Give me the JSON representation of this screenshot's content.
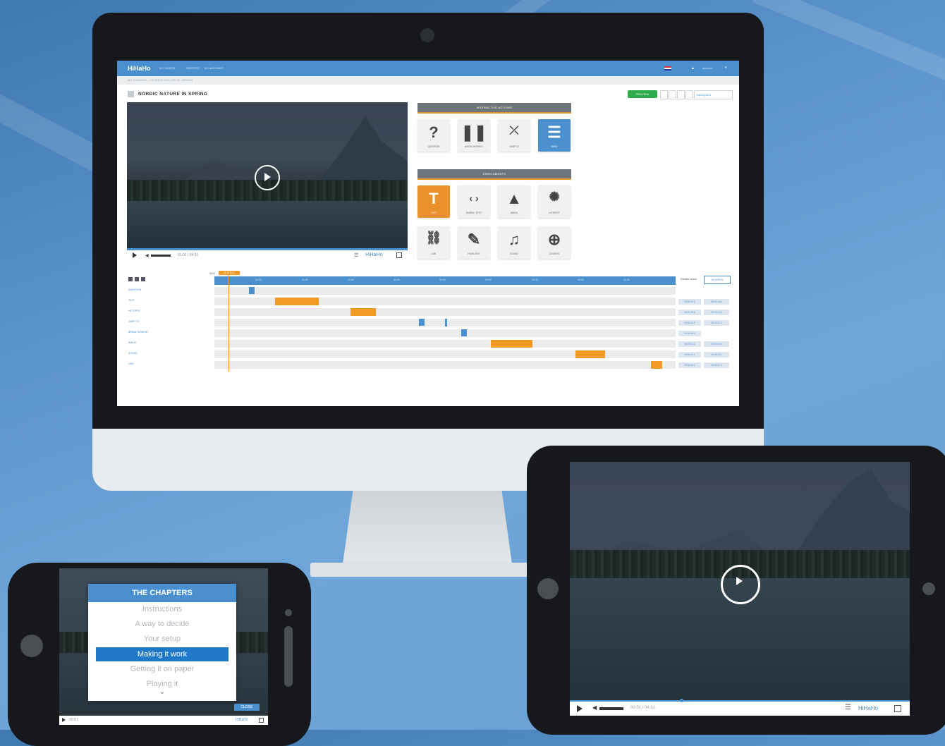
{
  "desktop": {
    "app": {
      "logo": "HiHaHo",
      "nav_items": [
        "MY VIDEOS",
        "SUPPORT",
        "MY ACCOUNT"
      ],
      "language_flag": "nl-flag-icon",
      "user_label": "account"
    },
    "breadcrumb": "MY CHANNEL > NORDIC NATURE IN SPRING",
    "video_title": "NORDIC NATURE IN SPRING",
    "toolbar": {
      "preview_label": "PREVIEW",
      "select_value": "Description"
    },
    "player": {
      "time": "01:01 / 04:31",
      "brand": "HiHaHo"
    },
    "interactive_actions": {
      "header": "INTERACTIVE ACTIONS",
      "tiles": [
        {
          "icon": "question-icon",
          "glyph": "?",
          "label": "QUESTION"
        },
        {
          "icon": "pause-icon",
          "glyph": "❚❚",
          "label": "BREAK MOMENT"
        },
        {
          "icon": "jump-to-icon",
          "glyph": "⤫",
          "label": "JUMP TO"
        },
        {
          "icon": "menu-icon",
          "glyph": "☰",
          "label": "MENU"
        }
      ]
    },
    "enrichments": {
      "header": "ENRICHMENTS",
      "tiles": [
        {
          "icon": "text-icon",
          "glyph": "T",
          "label": "TEXT"
        },
        {
          "icon": "code-icon",
          "glyph": "‹ ›",
          "label": "EMBED / TEXT"
        },
        {
          "icon": "image-icon",
          "glyph": "▲",
          "label": "IMAGE"
        },
        {
          "icon": "hotspot-icon",
          "glyph": "✺",
          "label": "HOTSPOT"
        },
        {
          "icon": "link-icon",
          "glyph": "⛓",
          "label": "LINK"
        },
        {
          "icon": "highlight-icon",
          "glyph": "✎",
          "label": "HIGHLIGHT"
        },
        {
          "icon": "music-icon",
          "glyph": "♫",
          "label": "SOUND"
        },
        {
          "icon": "zoom-icon",
          "glyph": "⊕",
          "label": "ZOOM IN"
        }
      ]
    },
    "timeline": {
      "ticks": [
        "00:00",
        "00:30",
        "01:00",
        "01:30",
        "02:00",
        "02:30",
        "03:00",
        "03:30",
        "04:00",
        "04:30"
      ],
      "cursor_time": "00:01:01.0",
      "details_label": "Details video",
      "details_button": "WIJZIGEN",
      "rows": [
        {
          "label": "QUESTION",
          "start": "",
          "end": ""
        },
        {
          "label": "TEXT",
          "start": "00:00:32.9",
          "end": "00:01:14.0"
        },
        {
          "label": "HOTSPOT",
          "start": "00:01:49.9",
          "end": "00:02:12.6"
        },
        {
          "label": "JUMP TO",
          "start": "00:02:44.9",
          "end": "00:02:47.6"
        },
        {
          "label": "BREAK MOMENT",
          "start": "00:03:06.9",
          "end": ""
        },
        {
          "label": "IMAGE",
          "start": "00:03:04.2",
          "end": "00:03:40.5"
        },
        {
          "label": "SOUND",
          "start": "00:04:03.1",
          "end": "00:04:28.1"
        },
        {
          "label": "LINK",
          "start": "00:04:40.0",
          "end": "00:04:47.0"
        }
      ]
    }
  },
  "tablet": {
    "time": "00:01 / 04:31",
    "brand": "HiHaHo"
  },
  "phone": {
    "chapters_title": "THE CHAPTERS",
    "chapters": [
      "Instructions",
      "A way to decide",
      "Your setup",
      "Making it work",
      "Getting it on paper",
      "Playing it"
    ],
    "active_chapter": "Making it work",
    "close_label": "CLOSE",
    "time": "00:01",
    "brand": "HiHaHo"
  },
  "colors": {
    "primary": "#4a8fce",
    "accent": "#f19b26",
    "success": "#2eab4b"
  }
}
